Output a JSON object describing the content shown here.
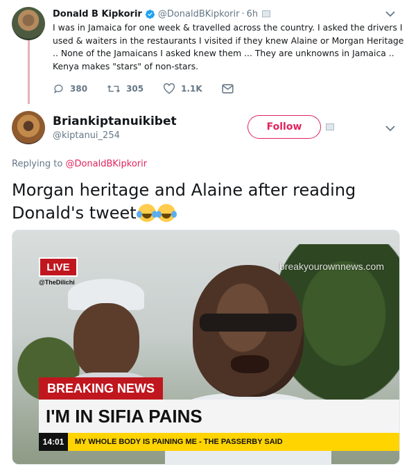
{
  "parent_tweet": {
    "name": "Donald B Kipkorir",
    "handle": "@DonaldBKipkorir",
    "separator": "·",
    "time": "6h",
    "text_lines": [
      "I was in Jamaica for one week & travelled across the country. I asked the drivers I",
      "used & waiters in the restaurants I visited if they knew Alaine or Morgan Heritage",
      ".. None of the Jamaicans I asked knew them ... They are unknowns in Jamaica ..",
      "Kenya makes \"stars\" of non-stars."
    ],
    "replies": "380",
    "retweets": "305",
    "likes": "1.1K"
  },
  "reply_tweet": {
    "name": "Briankiptanuikibet",
    "handle": "@kiptanui_254",
    "follow_label": "Follow",
    "replying_prefix": "Replying to",
    "replying_to": "@DonaldBKipkorir",
    "text_line1": "Morgan heritage and Alaine  after reading",
    "text_line2": "Donald's tweet"
  },
  "image": {
    "live_label": "LIVE",
    "channel_handle": "@TheDilichi",
    "watermark": "breakyourownnews.com",
    "breaking_label": "BREAKING NEWS",
    "headline": "I'M IN SIFIA PAINS",
    "ticker_time": "14:01",
    "ticker_text": "MY WHOLE BODY IS PAINING ME - THE PASSERBY SAID"
  },
  "colors": {
    "accent": "#e0245e",
    "muted": "#657786",
    "breaking_red": "#c0171f",
    "ticker_yellow": "#ffd400"
  }
}
